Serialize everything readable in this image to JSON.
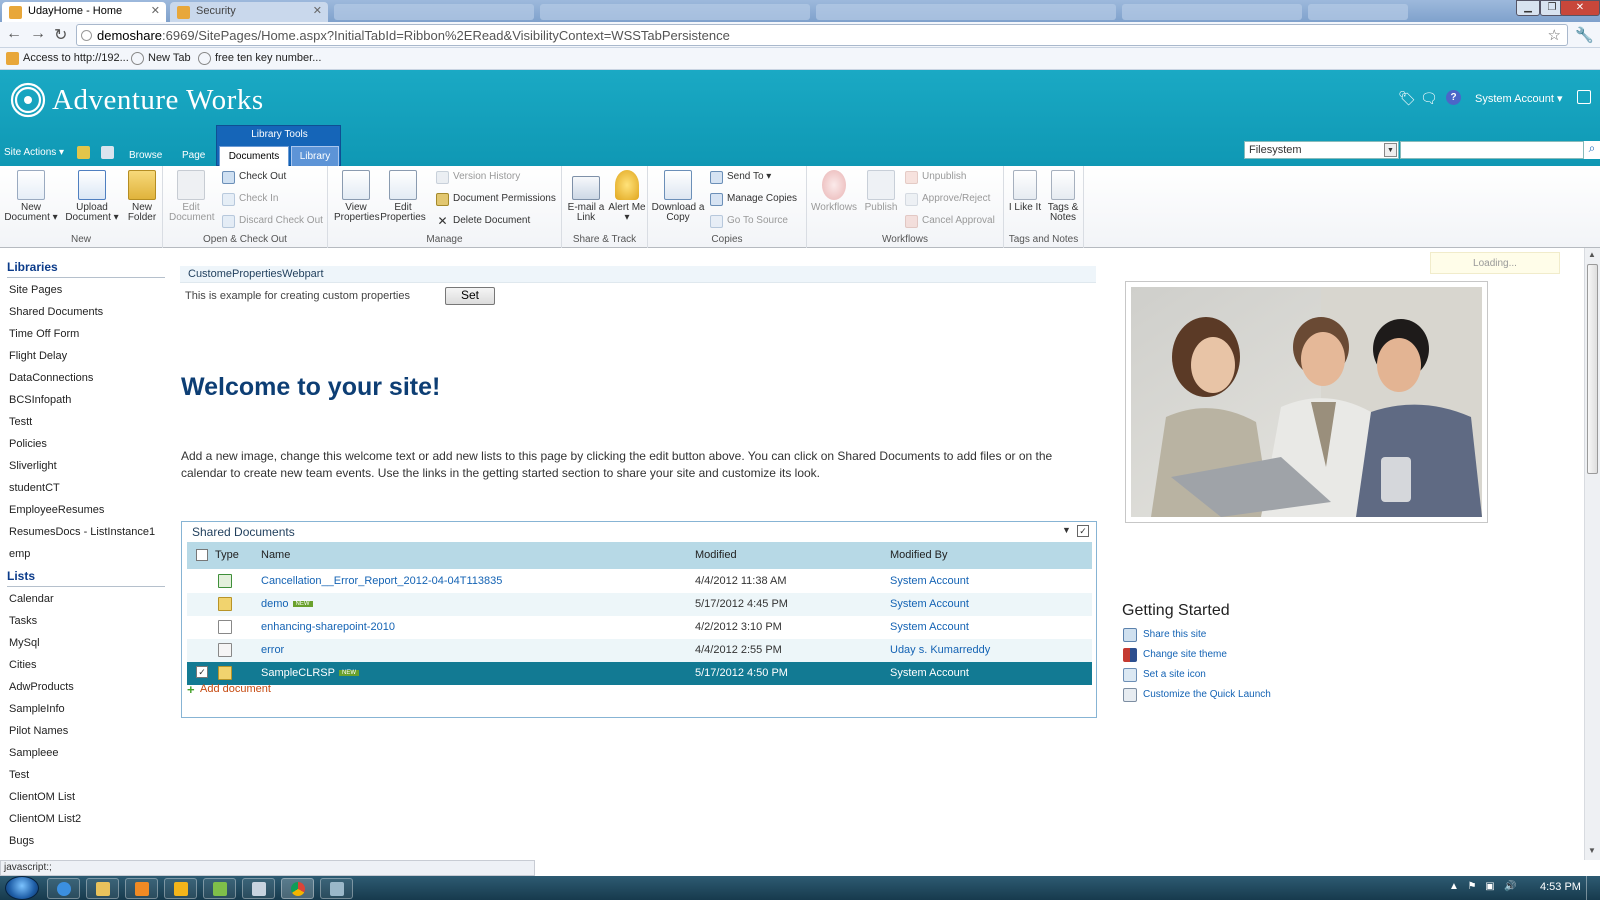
{
  "browser": {
    "tabs": [
      {
        "title": "UdayHome - Home",
        "active": true
      },
      {
        "title": "Security",
        "active": false
      }
    ],
    "url_host": "demoshare",
    "url_rest": ":6969/SitePages/Home.aspx?InitialTabId=Ribbon%2ERead&VisibilityContext=WSSTabPersistence",
    "bookmarks": [
      "Access to http://192...",
      "New Tab",
      "free ten key number..."
    ],
    "status_text": "javascript:;"
  },
  "header": {
    "site_title": "Adventure Works",
    "account": "System Account",
    "account_caret": "▾",
    "site_actions": "Site Actions ▾",
    "tabs": {
      "browse": "Browse",
      "page": "Page"
    },
    "library_tools_label": "Library Tools",
    "tab_documents": "Documents",
    "tab_library": "Library",
    "search_scope": "Filesystem",
    "brand_color": "#15a3bf"
  },
  "ribbon": {
    "new_group": {
      "label": "New",
      "new_document": "New Document ▾",
      "upload_document": "Upload Document ▾",
      "new_folder": "New Folder"
    },
    "open_group": {
      "label": "Open & Check Out",
      "edit_document": "Edit Document",
      "check_out": "Check Out",
      "check_in": "Check In",
      "discard_check_out": "Discard Check Out"
    },
    "manage_group": {
      "label": "Manage",
      "view_properties": "View Properties",
      "edit_properties": "Edit Properties",
      "version_history": "Version History",
      "document_permissions": "Document Permissions",
      "delete_document": "Delete Document"
    },
    "share_group": {
      "label": "Share & Track",
      "email_link": "E-mail a Link",
      "alert_me": "Alert Me ▾"
    },
    "copies_group": {
      "label": "Copies",
      "download_copy": "Download a Copy",
      "send_to": "Send To ▾",
      "manage_copies": "Manage Copies",
      "go_to_source": "Go To Source"
    },
    "workflows_group": {
      "label": "Workflows",
      "workflows": "Workflows",
      "publish": "Publish",
      "unpublish": "Unpublish",
      "approve_reject": "Approve/Reject",
      "cancel_approval": "Cancel Approval"
    },
    "tags_group": {
      "label": "Tags and Notes",
      "i_like_it": "I Like It",
      "tags_notes": "Tags & Notes"
    }
  },
  "leftnav": {
    "libraries_heading": "Libraries",
    "libraries": [
      "Site Pages",
      "Shared Documents",
      "Time Off Form",
      "Flight Delay",
      "DataConnections",
      "BCSInfopath",
      "Testt",
      "Policies",
      "Sliverlight",
      "studentCT",
      "EmployeeResumes",
      "ResumesDocs - ListInstance1",
      "emp"
    ],
    "lists_heading": "Lists",
    "lists": [
      "Calendar",
      "Tasks",
      "MySql",
      "Cities",
      "AdwProducts",
      "SampleInfo",
      "Pilot Names",
      "Sampleee",
      "Test",
      "ClientOM List",
      "ClientOM List2",
      "Bugs"
    ]
  },
  "main": {
    "webpart_title": "CustomePropertiesWebpart",
    "webpart_text": "This is example for creating custom properties",
    "set_button": "Set",
    "welcome_heading": "Welcome to your site!",
    "welcome_body": "Add a new image, change this welcome text or add new lists to this page by clicking the edit button above. You can click on Shared Documents to add files or on the calendar to create new team events. Use the links in the getting started section to share your site and customize its look.",
    "doclib": {
      "title": "Shared Documents",
      "columns": {
        "type": "Type",
        "name": "Name",
        "modified": "Modified",
        "modified_by": "Modified By"
      },
      "new_badge": "NEW",
      "add_document": "Add document",
      "rows": [
        {
          "name": "Cancellation__Error_Report_2012-04-04T113835",
          "modified": "4/4/2012 11:38 AM",
          "modified_by": "System Account",
          "icon": "excel-file-icon"
        },
        {
          "name": "demo",
          "modified": "5/17/2012 4:45 PM",
          "modified_by": "System Account",
          "icon": "folder-icon"
        },
        {
          "name": "enhancing-sharepoint-2010",
          "modified": "4/2/2012 3:10 PM",
          "modified_by": "System Account",
          "icon": "generic-file-icon"
        },
        {
          "name": "error",
          "modified": "4/4/2012 2:55 PM",
          "modified_by": "Uday s. Kumarreddy",
          "icon": "text-file-icon"
        },
        {
          "name": "SampleCLRSP",
          "modified": "5/17/2012 4:50 PM",
          "modified_by": "System Account",
          "icon": "folder-icon"
        }
      ]
    }
  },
  "right": {
    "loading": "Loading...",
    "getting_started_title": "Getting Started",
    "links": [
      "Share this site",
      "Change site theme",
      "Set a site icon",
      "Customize the Quick Launch"
    ]
  },
  "taskbar": {
    "clock": "4:53 PM"
  }
}
